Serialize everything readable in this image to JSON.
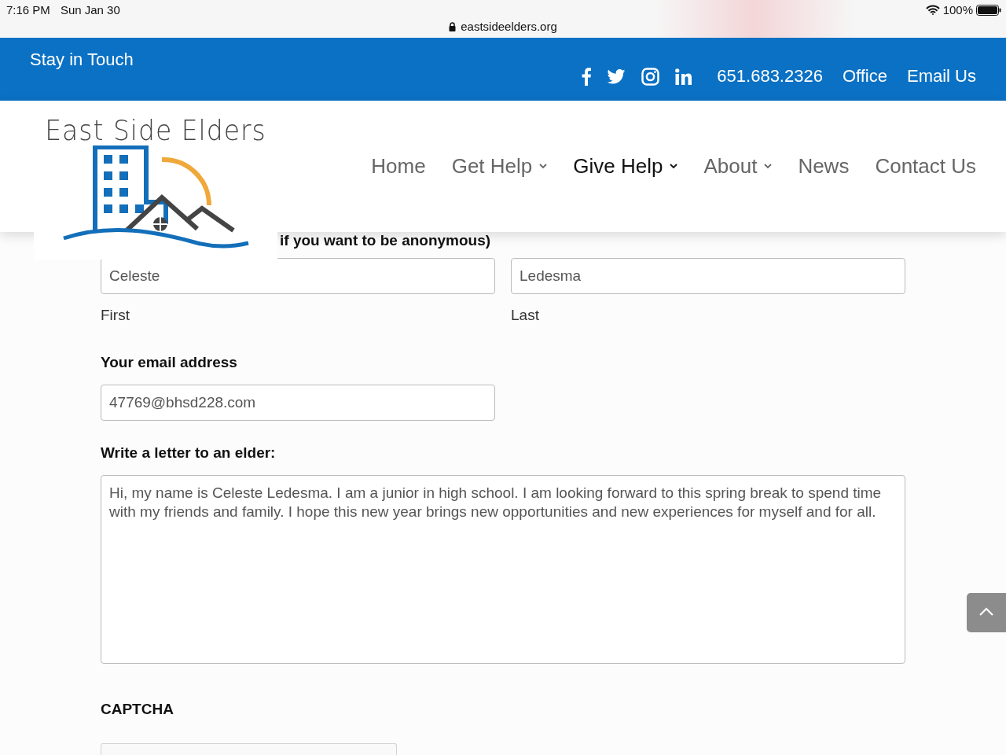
{
  "status_bar": {
    "time": "7:16 PM",
    "date": "Sun Jan 30",
    "url": "eastsideelders.org",
    "battery": "100%"
  },
  "top_bar": {
    "title": "Stay in Touch",
    "phone": "651.683.2326",
    "links": [
      "Office",
      "Email Us"
    ]
  },
  "header": {
    "logo_text": "East Side Elders",
    "nav": [
      {
        "label": "Home",
        "selected": false,
        "has_dropdown": false
      },
      {
        "label": "Get Help",
        "selected": false,
        "has_dropdown": true
      },
      {
        "label": "Give Help",
        "selected": true,
        "has_dropdown": true
      },
      {
        "label": "About",
        "selected": false,
        "has_dropdown": true
      },
      {
        "label": "News",
        "selected": false,
        "has_dropdown": false
      },
      {
        "label": "Contact Us",
        "selected": false,
        "has_dropdown": false
      }
    ]
  },
  "form": {
    "name_hint": "if you want to be anonymous)",
    "name_fields": [
      {
        "value": "Celeste",
        "sublabel": "First"
      },
      {
        "value": "Ledesma",
        "sublabel": "Last"
      }
    ],
    "email_label": "Your email address",
    "email_value": "47769@bhsd228.com",
    "letter_label": "Write a letter to an elder:",
    "letter_value": "Hi, my name is Celeste Ledesma. I am a junior in high school. I am looking forward to this spring break to spend time with my friends and family. I hope this new year brings new opportunities and new experiences for myself and for all.",
    "captcha_label": "CAPTCHA"
  }
}
